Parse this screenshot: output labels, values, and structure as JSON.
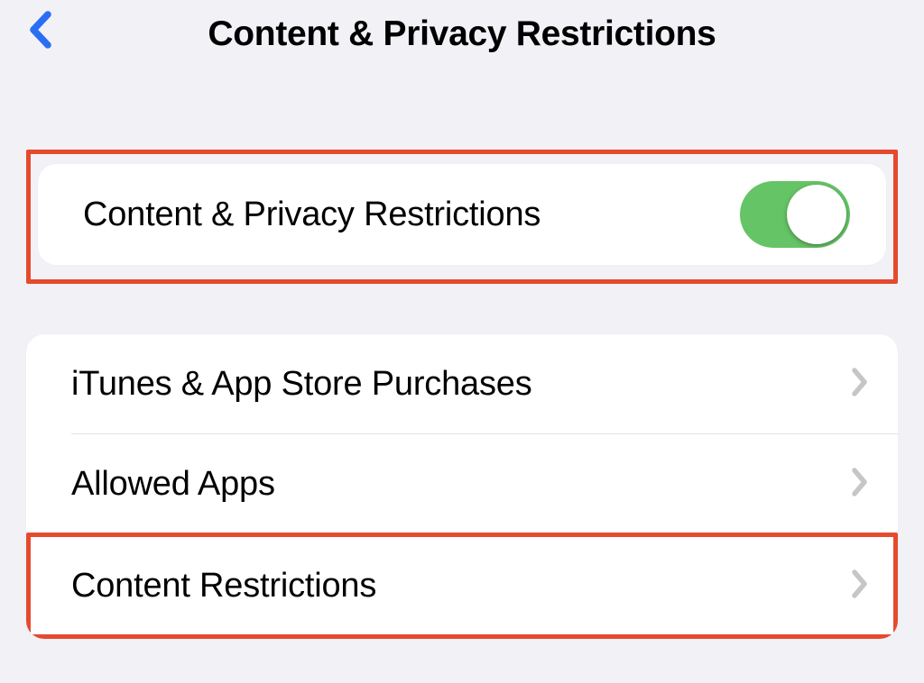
{
  "header": {
    "title": "Content & Privacy Restrictions"
  },
  "main_toggle": {
    "label": "Content & Privacy Restrictions",
    "enabled": true
  },
  "menu": {
    "items": [
      {
        "label": "iTunes & App Store Purchases"
      },
      {
        "label": "Allowed Apps"
      },
      {
        "label": "Content Restrictions"
      }
    ]
  },
  "colors": {
    "toggle_on": "#65c466",
    "highlight": "#e54a2e",
    "back_arrow": "#2a6ff3"
  }
}
